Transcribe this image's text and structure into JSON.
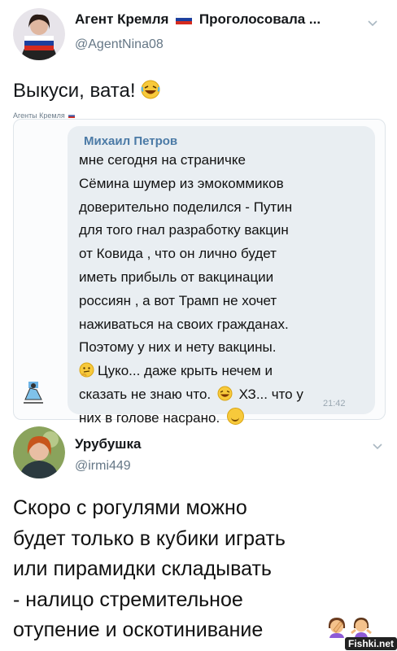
{
  "tweet1": {
    "display_name": "Агент Кремля",
    "vote_text": "Проголосовала ...",
    "handle": "@AgentNina08",
    "text": "Выкуси, вата!",
    "caption": "Агенты Кремля",
    "flag_colors": [
      "#ffffff",
      "#1c3f9e",
      "#d52b1e"
    ]
  },
  "chat": {
    "sender": "Михаил Петров",
    "lines": [
      "мне сегодня на страничке",
      "Сёмина шумер из эмокоммиков",
      "доверительно поделился - Путин",
      "для того гнал разработку вакцин",
      "от Ковида , что он лично будет",
      "иметь прибыль от вакцинации",
      "россиян , а вот Трамп не хочет",
      "наживаться на своих гражданах.",
      "Поэтому у них и нету вакцины."
    ],
    "line10": "Цуко... даже крыть нечем и",
    "line11a": "сказать не знаю что.",
    "line11b": "ХЗ... что у",
    "line12": "них в голове насрано.",
    "time": "21:42"
  },
  "tweet2": {
    "display_name": "Урубушка",
    "handle": "@irmi449",
    "lines": [
      "Скоро с рогулями можно",
      "будет только в кубики играть",
      "или пирамидки складывать",
      "- налицо стремительное",
      "отупение и оскотинивание"
    ]
  },
  "watermark": "Fishki.net",
  "icons": {
    "chevron": "chevron-down-icon",
    "smile": "smiling-face-icon"
  },
  "colors": {
    "name": "#14171a",
    "handle": "#657786",
    "bubble": "#e9eef2",
    "sender": "#4b7aa6"
  }
}
